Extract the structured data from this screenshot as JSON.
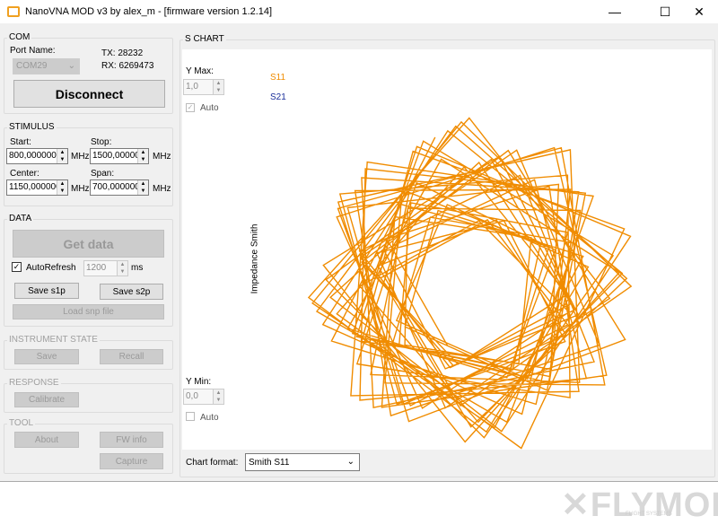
{
  "window": {
    "title": "NanoVNA MOD v3 by alex_m - [firmware version 1.2.14]",
    "minimize": "—",
    "maximize": "☐",
    "close": "✕"
  },
  "com": {
    "legend": "COM",
    "port_label": "Port Name:",
    "port_value": "COM29",
    "tx": "TX: 28232",
    "rx": "RX: 6269473",
    "disconnect": "Disconnect"
  },
  "stimulus": {
    "legend": "STIMULUS",
    "start_label": "Start:",
    "start": "800,000000",
    "stop_label": "Stop:",
    "stop": "1500,000000",
    "center_label": "Center:",
    "center": "1150,000000",
    "span_label": "Span:",
    "span": "700,000000",
    "unit": "MHz"
  },
  "data": {
    "legend": "DATA",
    "get_data": "Get data",
    "autorefresh": "AutoRefresh",
    "autorefresh_checked": true,
    "interval": "1200",
    "interval_unit": "ms",
    "save_s1p": "Save s1p",
    "save_s2p": "Save s2p",
    "load": "Load snp file"
  },
  "instrument": {
    "legend": "INSTRUMENT STATE",
    "save": "Save",
    "recall": "Recall"
  },
  "response": {
    "legend": "RESPONSE",
    "calibrate": "Calibrate"
  },
  "tool": {
    "legend": "TOOL",
    "about": "About",
    "fw_info": "FW info",
    "capture": "Capture"
  },
  "chart": {
    "legend": "S CHART",
    "ymax_label": "Y Max:",
    "ymax": "1,0",
    "auto": "Auto",
    "auto_max_checked": true,
    "ymin_label": "Y Min:",
    "ymin": "0,0",
    "auto_min_checked": false,
    "s11": "S11",
    "s21": "S21",
    "axis_label": "Impedance Smith",
    "format_label": "Chart format:",
    "format": "Smith S11",
    "colors": {
      "s11": "#f08c00",
      "s21": "#1a2f9a"
    }
  },
  "watermark": {
    "text": "FLYMOD",
    "sub": "FLIGHT SYSTEMS"
  }
}
